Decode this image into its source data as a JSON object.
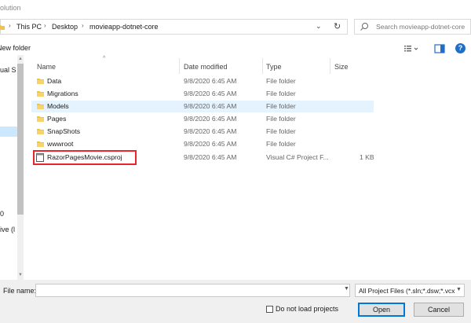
{
  "window": {
    "title": "olution"
  },
  "address": {
    "crumbs": [
      "This PC",
      "Desktop",
      "movieapp-dotnet-core"
    ],
    "search_placeholder": "Search movieapp-dotnet-core"
  },
  "toolbar": {
    "new_folder_label": "New folder",
    "help_label": "?"
  },
  "nav_pane": {
    "items": [
      "ual S",
      "0",
      "ive (l"
    ]
  },
  "columns": {
    "name": "Name",
    "date": "Date modified",
    "type": "Type",
    "size": "Size"
  },
  "files": [
    {
      "name": "Data",
      "date": "9/8/2020 6:45 AM",
      "type": "File folder",
      "size": "",
      "icon": "folder-icon"
    },
    {
      "name": "Migrations",
      "date": "9/8/2020 6:45 AM",
      "type": "File folder",
      "size": "",
      "icon": "folder-icon"
    },
    {
      "name": "Models",
      "date": "9/8/2020 6:45 AM",
      "type": "File folder",
      "size": "",
      "icon": "folder-icon"
    },
    {
      "name": "Pages",
      "date": "9/8/2020 6:45 AM",
      "type": "File folder",
      "size": "",
      "icon": "folder-icon"
    },
    {
      "name": "SnapShots",
      "date": "9/8/2020 6:45 AM",
      "type": "File folder",
      "size": "",
      "icon": "folder-icon"
    },
    {
      "name": "wwwroot",
      "date": "9/8/2020 6:45 AM",
      "type": "File folder",
      "size": "",
      "icon": "folder-icon"
    },
    {
      "name": "RazorPagesMovie.csproj",
      "date": "9/8/2020 6:45 AM",
      "type": "Visual C# Project F...",
      "size": "1 KB",
      "icon": "csproj-file-icon"
    }
  ],
  "footer": {
    "filename_label": "File name:",
    "filename_value": "",
    "filter_value": "All Project Files (*.sln;*.dsw;*.vcx",
    "no_load_label": "Do not load projects",
    "open_label": "Open",
    "cancel_label": "Cancel"
  },
  "colors": {
    "highlight_row": "#e5f3ff",
    "annotation_red": "#e8262b",
    "folder_yellow": "#f0c44c",
    "accent_blue": "#0078d7"
  }
}
